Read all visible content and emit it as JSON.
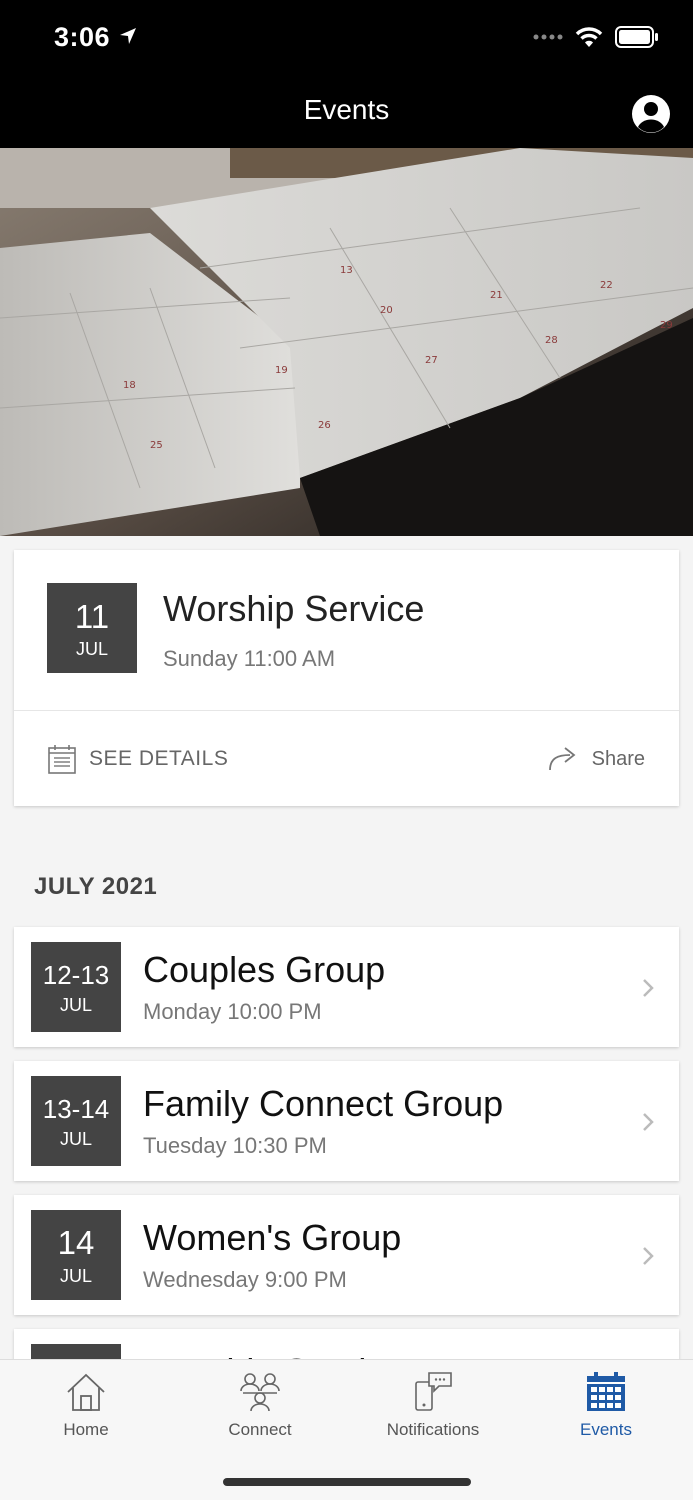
{
  "status_bar": {
    "time": "3:06"
  },
  "header": {
    "title": "Events"
  },
  "featured_event": {
    "day": "11",
    "month": "JUL",
    "title": "Worship Service",
    "time": "Sunday 11:00 AM",
    "see_details_label": "SEE DETAILS",
    "share_label": "Share"
  },
  "section": {
    "title": "JULY 2021"
  },
  "events": [
    {
      "day": "12-13",
      "month": "JUL",
      "title": "Couples Group",
      "time": "Monday 10:00 PM"
    },
    {
      "day": "13-14",
      "month": "JUL",
      "title": "Family Connect Group",
      "time": "Tuesday 10:30 PM"
    },
    {
      "day": "14",
      "month": "JUL",
      "title": "Women's Group",
      "time": "Wednesday 9:00 PM"
    },
    {
      "day": "",
      "month": "",
      "title": "Worship Service",
      "time": ""
    }
  ],
  "tabs": [
    {
      "label": "Home",
      "icon": "home-icon"
    },
    {
      "label": "Connect",
      "icon": "people-icon"
    },
    {
      "label": "Notifications",
      "icon": "notifications-icon"
    },
    {
      "label": "Events",
      "icon": "calendar-icon",
      "active": true
    }
  ],
  "colors": {
    "accent": "#1f5aa6",
    "badge": "#444444",
    "header": "#000000"
  }
}
